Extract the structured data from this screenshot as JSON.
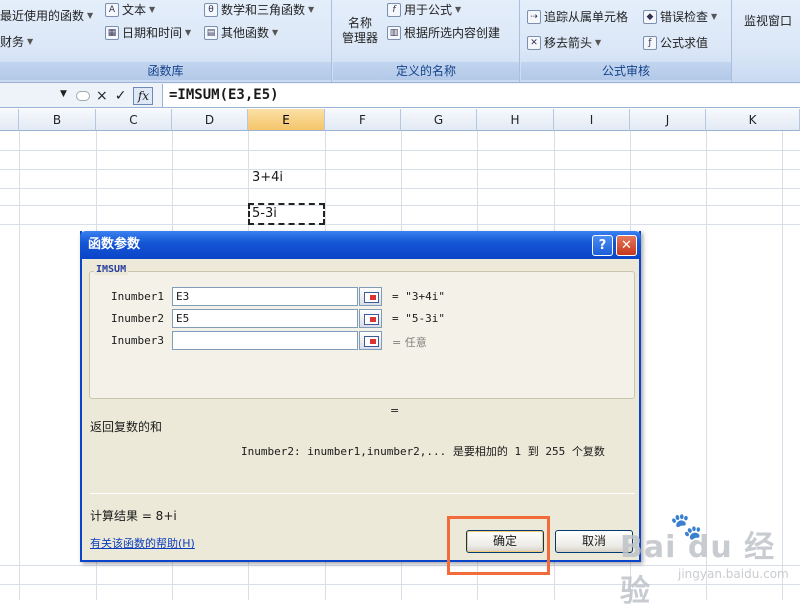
{
  "ribbon": {
    "groups": [
      {
        "caption": "函数库",
        "items": [
          "最近使用的函数",
          "文本",
          "数学和三角函数",
          "财务",
          "日期和时间",
          "其他函数"
        ]
      },
      {
        "caption": "定义的名称",
        "big": [
          "名称",
          "管理器"
        ],
        "items": [
          "用于公式",
          "根据所选内容创建"
        ]
      },
      {
        "caption": "公式审核",
        "items": [
          "追踪从属单元格",
          "错误检查",
          "移去箭头",
          "公式求值"
        ]
      },
      {
        "caption": "",
        "big": [
          "监视窗口"
        ]
      }
    ]
  },
  "formula_bar": {
    "cancel_glyph": "×",
    "enter_glyph": "✓",
    "fx_label": "fx",
    "formula": "=IMSUM(E3,E5)"
  },
  "columns": [
    "B",
    "C",
    "D",
    "E",
    "F",
    "G",
    "H",
    "I",
    "J",
    "K"
  ],
  "selected_column": "E",
  "cells": {
    "E3": "3+4i",
    "E5": "5-3i"
  },
  "dialog": {
    "title": "函数参数",
    "help_glyph": "?",
    "close_glyph": "✕",
    "function_name": "IMSUM",
    "args": [
      {
        "label": "Inumber1",
        "value": "E3",
        "result": "= \"3+4i\""
      },
      {
        "label": "Inumber2",
        "value": "E5",
        "result": "= \"5-3i\""
      },
      {
        "label": "Inumber3",
        "value": "",
        "result": "= 任意"
      }
    ],
    "eq_mark": "=",
    "description": "返回复数的和",
    "arg_description": "Inumber2:  inumber1,inumber2,... 是要相加的 1 到 255 个复数",
    "result_label": "计算结果 =  8+i",
    "help_link": "有关该函数的帮助(H)",
    "ok_label": "确定",
    "cancel_label": "取消"
  },
  "watermark": {
    "brand": "Bai du 经验",
    "url": "jingyan.baidu.com"
  },
  "colors": {
    "title_bar": "#0a44c8",
    "highlight_box": "#f26b3a",
    "selected_header": "#f5c56a"
  }
}
